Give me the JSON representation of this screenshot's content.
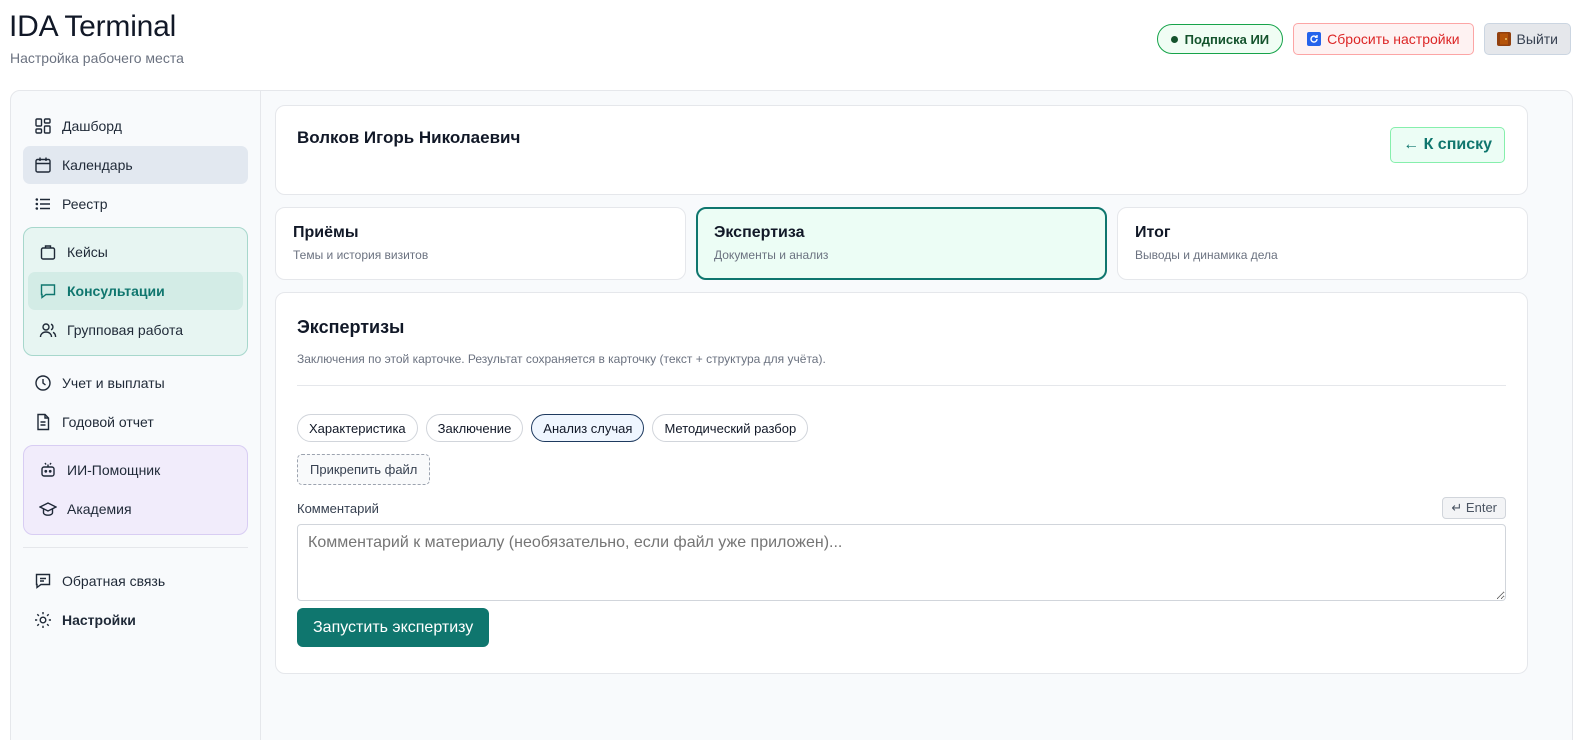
{
  "header": {
    "title": "IDA Terminal",
    "subtitle": "Настройка рабочего места",
    "subscription_label": "Подписка ИИ",
    "reset_label": "Сбросить настройки",
    "logout_label": "Выйти"
  },
  "sidebar": {
    "dashboard": "Дашборд",
    "calendar": "Календарь",
    "registry": "Реестр",
    "cases": "Кейсы",
    "consultations": "Консультации",
    "group_work": "Групповая работа",
    "accounting": "Учет и выплаты",
    "annual_report": "Годовой отчет",
    "ai_assistant": "ИИ-Помощник",
    "academy": "Академия",
    "feedback": "Обратная связь",
    "settings": "Настройки"
  },
  "client": {
    "name": "Волков Игорь Николаевич",
    "back_label": "← К списку"
  },
  "tabs": [
    {
      "title": "Приёмы",
      "subtitle": "Темы и история визитов"
    },
    {
      "title": "Экспертиза",
      "subtitle": "Документы и анализ"
    },
    {
      "title": "Итог",
      "subtitle": "Выводы и динамика дела"
    }
  ],
  "expertise": {
    "title": "Экспертизы",
    "description": "Заключения по этой карточке. Результат сохраняется в карточку (текст + структура для учёта).",
    "chips": [
      "Характеристика",
      "Заключение",
      "Анализ случая",
      "Методический разбор"
    ],
    "attach_label": "Прикрепить файл",
    "comment_label": "Комментарий",
    "enter_hint": "↵ Enter",
    "comment_placeholder": "Комментарий к материалу (необязательно, если файл уже приложен)...",
    "run_label": "Запустить экспертизу"
  },
  "colors": {
    "accent": "#0f766e",
    "danger": "#dc2626",
    "success_border": "#16a34a"
  }
}
